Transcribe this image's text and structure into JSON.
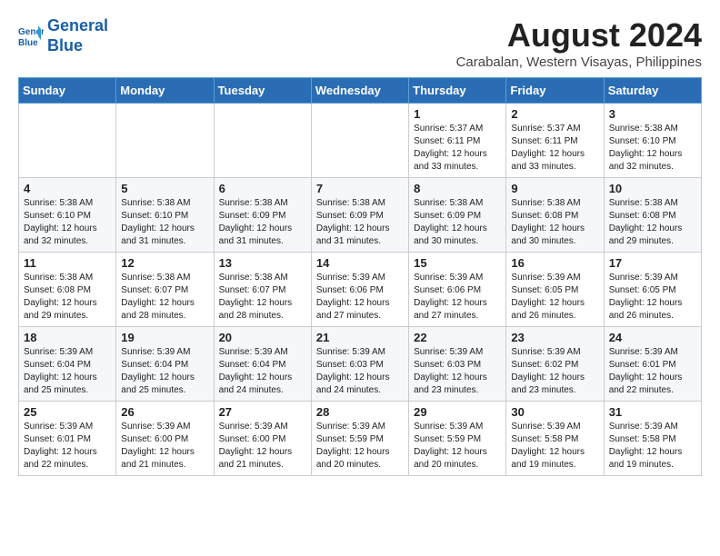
{
  "header": {
    "logo_line1": "General",
    "logo_line2": "Blue",
    "title": "August 2024",
    "subtitle": "Carabalan, Western Visayas, Philippines"
  },
  "days_of_week": [
    "Sunday",
    "Monday",
    "Tuesday",
    "Wednesday",
    "Thursday",
    "Friday",
    "Saturday"
  ],
  "weeks": [
    [
      {
        "day": "",
        "info": ""
      },
      {
        "day": "",
        "info": ""
      },
      {
        "day": "",
        "info": ""
      },
      {
        "day": "",
        "info": ""
      },
      {
        "day": "1",
        "info": "Sunrise: 5:37 AM\nSunset: 6:11 PM\nDaylight: 12 hours\nand 33 minutes."
      },
      {
        "day": "2",
        "info": "Sunrise: 5:37 AM\nSunset: 6:11 PM\nDaylight: 12 hours\nand 33 minutes."
      },
      {
        "day": "3",
        "info": "Sunrise: 5:38 AM\nSunset: 6:10 PM\nDaylight: 12 hours\nand 32 minutes."
      }
    ],
    [
      {
        "day": "4",
        "info": "Sunrise: 5:38 AM\nSunset: 6:10 PM\nDaylight: 12 hours\nand 32 minutes."
      },
      {
        "day": "5",
        "info": "Sunrise: 5:38 AM\nSunset: 6:10 PM\nDaylight: 12 hours\nand 31 minutes."
      },
      {
        "day": "6",
        "info": "Sunrise: 5:38 AM\nSunset: 6:09 PM\nDaylight: 12 hours\nand 31 minutes."
      },
      {
        "day": "7",
        "info": "Sunrise: 5:38 AM\nSunset: 6:09 PM\nDaylight: 12 hours\nand 31 minutes."
      },
      {
        "day": "8",
        "info": "Sunrise: 5:38 AM\nSunset: 6:09 PM\nDaylight: 12 hours\nand 30 minutes."
      },
      {
        "day": "9",
        "info": "Sunrise: 5:38 AM\nSunset: 6:08 PM\nDaylight: 12 hours\nand 30 minutes."
      },
      {
        "day": "10",
        "info": "Sunrise: 5:38 AM\nSunset: 6:08 PM\nDaylight: 12 hours\nand 29 minutes."
      }
    ],
    [
      {
        "day": "11",
        "info": "Sunrise: 5:38 AM\nSunset: 6:08 PM\nDaylight: 12 hours\nand 29 minutes."
      },
      {
        "day": "12",
        "info": "Sunrise: 5:38 AM\nSunset: 6:07 PM\nDaylight: 12 hours\nand 28 minutes."
      },
      {
        "day": "13",
        "info": "Sunrise: 5:38 AM\nSunset: 6:07 PM\nDaylight: 12 hours\nand 28 minutes."
      },
      {
        "day": "14",
        "info": "Sunrise: 5:39 AM\nSunset: 6:06 PM\nDaylight: 12 hours\nand 27 minutes."
      },
      {
        "day": "15",
        "info": "Sunrise: 5:39 AM\nSunset: 6:06 PM\nDaylight: 12 hours\nand 27 minutes."
      },
      {
        "day": "16",
        "info": "Sunrise: 5:39 AM\nSunset: 6:05 PM\nDaylight: 12 hours\nand 26 minutes."
      },
      {
        "day": "17",
        "info": "Sunrise: 5:39 AM\nSunset: 6:05 PM\nDaylight: 12 hours\nand 26 minutes."
      }
    ],
    [
      {
        "day": "18",
        "info": "Sunrise: 5:39 AM\nSunset: 6:04 PM\nDaylight: 12 hours\nand 25 minutes."
      },
      {
        "day": "19",
        "info": "Sunrise: 5:39 AM\nSunset: 6:04 PM\nDaylight: 12 hours\nand 25 minutes."
      },
      {
        "day": "20",
        "info": "Sunrise: 5:39 AM\nSunset: 6:04 PM\nDaylight: 12 hours\nand 24 minutes."
      },
      {
        "day": "21",
        "info": "Sunrise: 5:39 AM\nSunset: 6:03 PM\nDaylight: 12 hours\nand 24 minutes."
      },
      {
        "day": "22",
        "info": "Sunrise: 5:39 AM\nSunset: 6:03 PM\nDaylight: 12 hours\nand 23 minutes."
      },
      {
        "day": "23",
        "info": "Sunrise: 5:39 AM\nSunset: 6:02 PM\nDaylight: 12 hours\nand 23 minutes."
      },
      {
        "day": "24",
        "info": "Sunrise: 5:39 AM\nSunset: 6:01 PM\nDaylight: 12 hours\nand 22 minutes."
      }
    ],
    [
      {
        "day": "25",
        "info": "Sunrise: 5:39 AM\nSunset: 6:01 PM\nDaylight: 12 hours\nand 22 minutes."
      },
      {
        "day": "26",
        "info": "Sunrise: 5:39 AM\nSunset: 6:00 PM\nDaylight: 12 hours\nand 21 minutes."
      },
      {
        "day": "27",
        "info": "Sunrise: 5:39 AM\nSunset: 6:00 PM\nDaylight: 12 hours\nand 21 minutes."
      },
      {
        "day": "28",
        "info": "Sunrise: 5:39 AM\nSunset: 5:59 PM\nDaylight: 12 hours\nand 20 minutes."
      },
      {
        "day": "29",
        "info": "Sunrise: 5:39 AM\nSunset: 5:59 PM\nDaylight: 12 hours\nand 20 minutes."
      },
      {
        "day": "30",
        "info": "Sunrise: 5:39 AM\nSunset: 5:58 PM\nDaylight: 12 hours\nand 19 minutes."
      },
      {
        "day": "31",
        "info": "Sunrise: 5:39 AM\nSunset: 5:58 PM\nDaylight: 12 hours\nand 19 minutes."
      }
    ]
  ]
}
